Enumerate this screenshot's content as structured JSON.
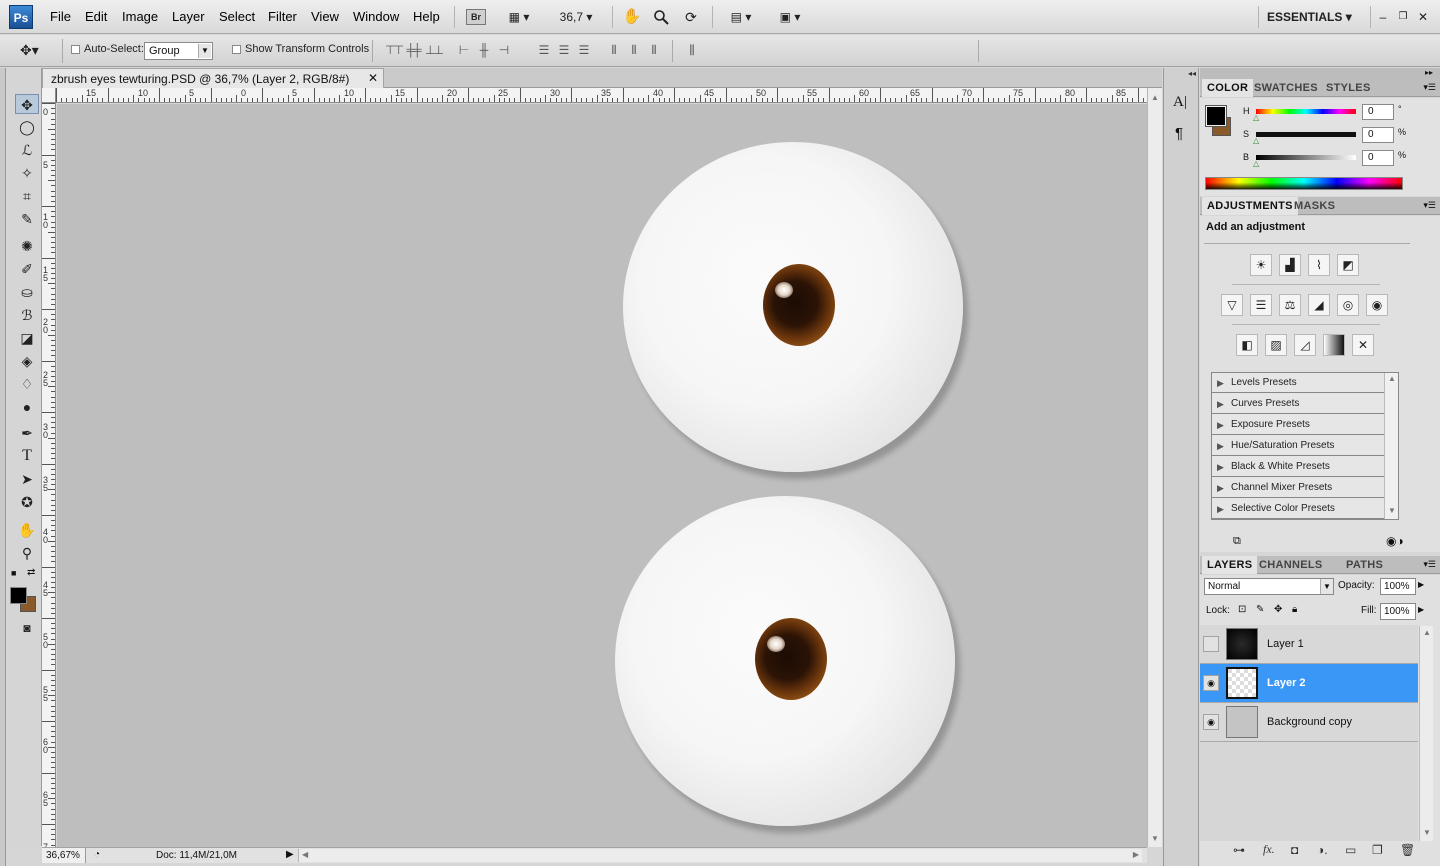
{
  "app": {
    "logo": "Ps"
  },
  "menu": [
    "File",
    "Edit",
    "Image",
    "Layer",
    "Select",
    "Filter",
    "View",
    "Window",
    "Help"
  ],
  "menubar": {
    "bridge_label": "Br",
    "zoom_value": "36,7",
    "workspace": "ESSENTIALS",
    "icons": [
      "bridge-icon",
      "mini-bridge-icon",
      "hand-icon",
      "zoom-icon",
      "rotate-view-icon",
      "arrange-documents-icon",
      "screen-mode-icon"
    ],
    "window_controls": [
      "minimize-icon",
      "restore-icon",
      "close-icon"
    ]
  },
  "options": {
    "auto_select_label": "Auto-Select:",
    "auto_select_value": "Group",
    "transform_label": "Show Transform Controls"
  },
  "document": {
    "tab_title": "zbrush eyes  tewturing.PSD @ 36,7% (Layer 2, RGB/8#)",
    "zoom_status": "36,67%",
    "doc_size": "Doc: 11,4M/21,0M"
  },
  "ruler_h": [
    "15",
    "10",
    "5",
    "0",
    "5",
    "10",
    "15",
    "20",
    "25",
    "30",
    "35",
    "40",
    "45",
    "50",
    "55",
    "60",
    "65",
    "70",
    "75",
    "80",
    "85"
  ],
  "ruler_v": [
    "0",
    "5",
    "1\n0",
    "1\n5",
    "2\n0",
    "2\n5",
    "3\n0",
    "3\n5",
    "4\n0",
    "4\n5",
    "5\n0",
    "5\n5",
    "6\n0",
    "6\n5",
    "7"
  ],
  "color_panel": {
    "tabs": [
      "COLOR",
      "SWATCHES",
      "STYLES"
    ],
    "h_label": "H",
    "h_value": "0",
    "h_unit": "°",
    "s_label": "S",
    "s_value": "0",
    "s_unit": "%",
    "b_label": "B",
    "b_value": "0",
    "b_unit": "%",
    "foreground": "#000000",
    "background": "#8b5a2b"
  },
  "adjustments_panel": {
    "tabs": [
      "ADJUSTMENTS",
      "MASKS"
    ],
    "heading": "Add an adjustment",
    "icons_row1": [
      "brightness-contrast-icon",
      "levels-icon",
      "curves-icon",
      "exposure-icon"
    ],
    "icons_row2": [
      "vibrance-icon",
      "hue-saturation-icon",
      "color-balance-icon",
      "black-white-icon",
      "photo-filter-icon",
      "channel-mixer-icon"
    ],
    "icons_row3": [
      "invert-icon",
      "posterize-icon",
      "threshold-icon",
      "gradient-map-icon",
      "selective-color-icon"
    ],
    "presets": [
      "Levels Presets",
      "Curves Presets",
      "Exposure Presets",
      "Hue/Saturation Presets",
      "Black & White Presets",
      "Channel Mixer Presets",
      "Selective Color Presets"
    ]
  },
  "layers_panel": {
    "tabs": [
      "LAYERS",
      "CHANNELS",
      "PATHS"
    ],
    "blend_mode": "Normal",
    "opacity_label": "Opacity:",
    "opacity": "100%",
    "lock_label": "Lock:",
    "fill_label": "Fill:",
    "fill": "100%",
    "layers": [
      {
        "name": "Layer 1",
        "visible": false,
        "selected": false
      },
      {
        "name": "Layer 2",
        "visible": true,
        "selected": true
      },
      {
        "name": "Background copy",
        "visible": true,
        "selected": false
      }
    ]
  },
  "colors": {
    "selection": "#3b97f5",
    "canvas": "#bebebe",
    "iris": "#6a350c"
  }
}
